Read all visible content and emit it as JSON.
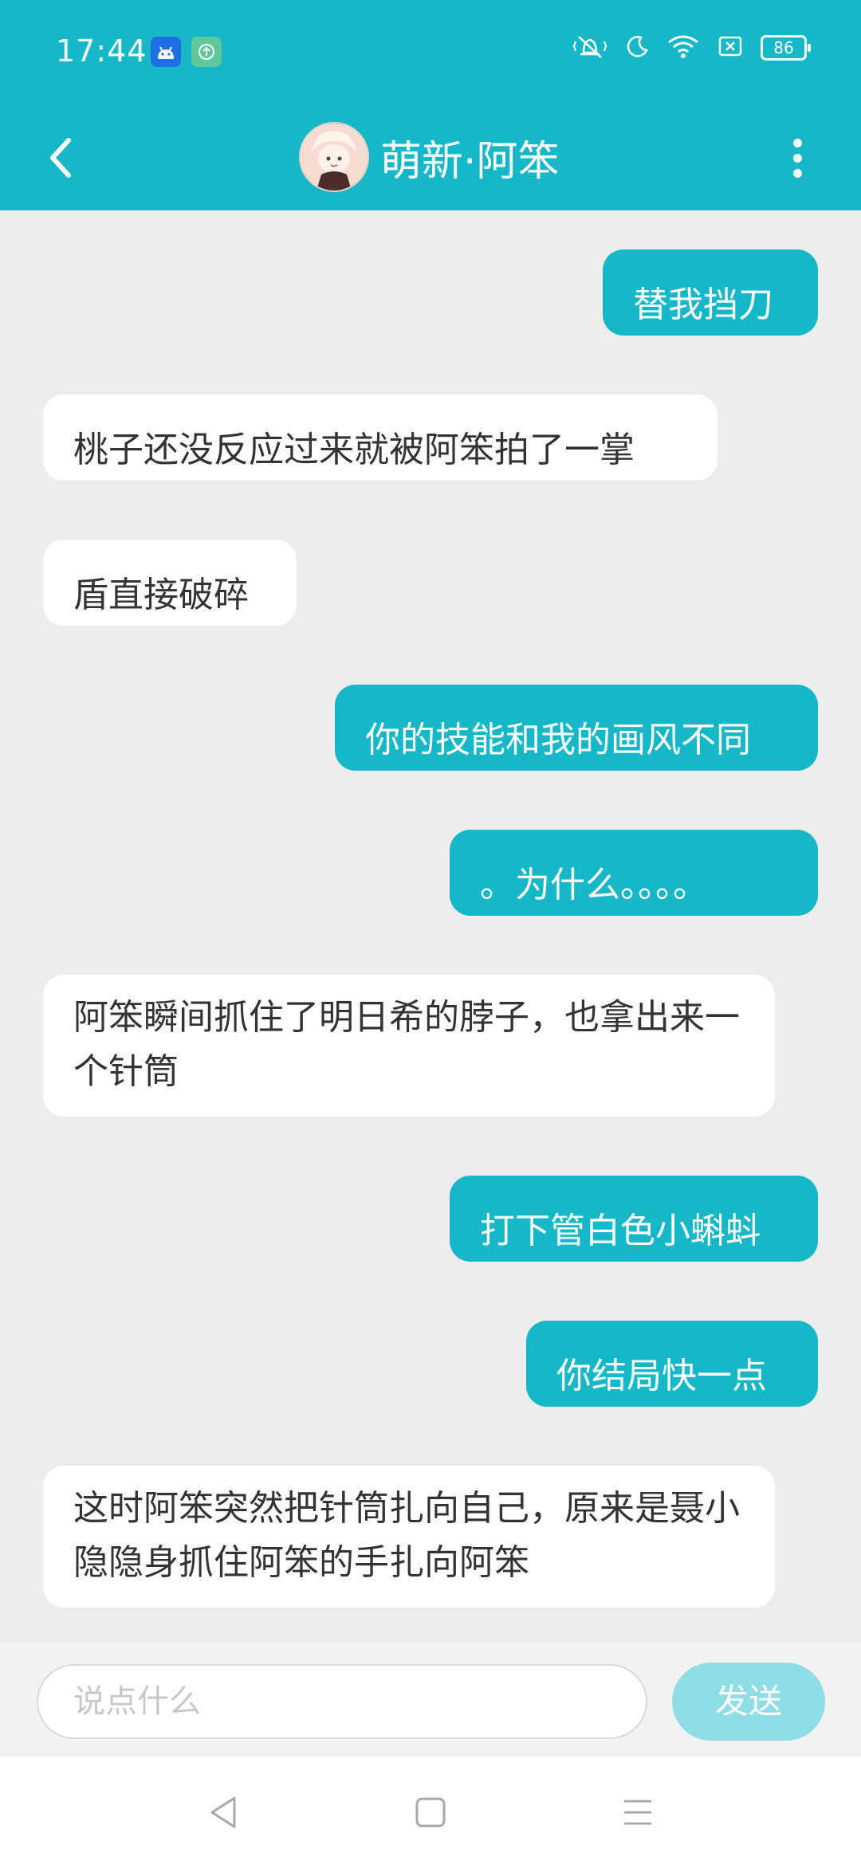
{
  "status_bar": {
    "time": "17:44",
    "battery": "86",
    "icons": [
      "android-icon",
      "upload-icon",
      "mute-vibrate-icon",
      "moon-icon",
      "wifi-icon",
      "sim-off-icon",
      "battery-icon"
    ]
  },
  "header": {
    "title": "萌新·阿笨",
    "back_icon": "chevron-left-icon",
    "more_icon": "more-vertical-icon"
  },
  "messages": [
    {
      "side": "out",
      "text": "替我挡刀"
    },
    {
      "side": "in",
      "text": "桃子还没反应过来就被阿笨拍了一掌"
    },
    {
      "side": "in",
      "text": "盾直接破碎"
    },
    {
      "side": "out",
      "text": "你的技能和我的画风不同"
    },
    {
      "side": "out",
      "text": "。为什么。。。。"
    },
    {
      "side": "in",
      "text": "阿笨瞬间抓住了明日希的脖子，也拿出来一个针筒"
    },
    {
      "side": "out",
      "text": "打下管白色小蝌蚪"
    },
    {
      "side": "out",
      "text": "你结局快一点"
    },
    {
      "side": "in",
      "text": "这时阿笨突然把针筒扎向自己，原来是聂小隐隐身抓住阿笨的手扎向阿笨"
    }
  ],
  "input": {
    "placeholder": "说点什么",
    "send_label": "发送"
  },
  "colors": {
    "accent": "#16b7c6",
    "send_disabled": "#8fdde5",
    "chat_bg": "#ededed"
  }
}
